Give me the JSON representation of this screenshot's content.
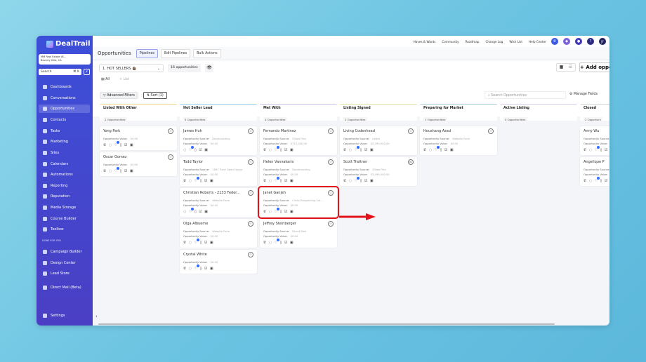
{
  "app": {
    "name": "DealTrail",
    "account": "MM Real Estate (B...",
    "account_location": "Beverly Hills, CA",
    "search_placeholder": "Search",
    "search_shortcut": "⌘ K"
  },
  "sidebar": {
    "items": [
      "Dashboards",
      "Conversations",
      "Opportunities",
      "Contacts",
      "Tasks",
      "Marketing",
      "Sites",
      "Calendars",
      "Automations",
      "Reporting",
      "Reputation",
      "Media Storage",
      "Course Builder",
      "Toolbox"
    ],
    "section": "DONE FOR YOU",
    "extra": [
      "Campaign Builder",
      "Design Center",
      "Lead Store",
      "Direct Mail (Beta)"
    ],
    "settings": "Settings",
    "active": "Opportunities"
  },
  "topbar": {
    "links": [
      "Haves & Wants",
      "Community",
      "Roadmap",
      "Change Log",
      "Wish List",
      "Help Center"
    ],
    "avatar": "JF"
  },
  "header": {
    "title": "Opportunities",
    "tabs": [
      "Pipelines",
      "Edit Pipelines",
      "Bulk Actions"
    ]
  },
  "toolbar": {
    "pipeline": "1. HOT SELLERS 🏚️",
    "count": "16 opportunities",
    "add": "Add opportunity",
    "all": "All",
    "list": "+ List",
    "filters": "Advanced Filters",
    "sort": "Sort (1)",
    "search_placeholder": "Search Opportunities",
    "manage": "Manage Fields"
  },
  "labels": {
    "source": "Opportunity Source:",
    "value": "Opportunity Value:"
  },
  "columns": [
    {
      "name": "Listed With Other",
      "count": "2 Opportunities",
      "color": "#f2d98a",
      "cards": [
        {
          "name": "Yong Park",
          "value": "$0.00",
          "phone": true
        },
        {
          "name": "Oscar Gomez",
          "value": "$0.00",
          "phone": true
        }
      ]
    },
    {
      "name": "Hot Seller Lead",
      "count": "5 Opportunities",
      "color": "#8fd0ea",
      "cards": [
        {
          "name": "James Huh",
          "source": "Doorknocking",
          "value": "$0.00",
          "phone": false
        },
        {
          "name": "Todd Taylor",
          "source": "1587 Turin Open House",
          "value": "$0.00",
          "phone": true
        },
        {
          "name": "Christian Roberts - 2133 Feder...",
          "source": "Website Form",
          "value": "$0.00",
          "phone": false
        },
        {
          "name": "Olga Albueme",
          "source": "Website Form",
          "value": "$0.00",
          "phone": true
        },
        {
          "name": "Crystal White",
          "value": "$0.00",
          "phone": true
        }
      ]
    },
    {
      "name": "Met With",
      "count": "4 Opportunities",
      "color": "#c9c3ea",
      "cards": [
        {
          "name": "Fernando Martinez",
          "source": "Zillow Flex",
          "value": "$710,000.00",
          "phone": true
        },
        {
          "name": "Helen Vanvakaris",
          "source": "Doorknocking",
          "value": "$0.00",
          "phone": true
        },
        {
          "name": "Janet Ganjeh",
          "source": "Circle Prospecting Cal...",
          "value": "$0.00",
          "phone": true,
          "highlight": true
        },
        {
          "name": "Jeffrey Steinberger",
          "source": "Direct Mail",
          "value": "$0.00",
          "phone": true
        }
      ]
    },
    {
      "name": "Listing Signed",
      "count": "2 Opportunities",
      "color": "#dfe39a",
      "cards": [
        {
          "name": "Living Codenhead",
          "source": "Letter",
          "value": "$3,490,000.00",
          "phone": true
        },
        {
          "name": "Scott Trattner",
          "source": "Zillow Flex",
          "value": "$3,499,000.00",
          "phone": true,
          "avatar": "JD"
        }
      ]
    },
    {
      "name": "Preparing for Market",
      "count": "1 Opportunities",
      "color": "#a9cdd6",
      "cards": [
        {
          "name": "Houshang Azad",
          "source": "Website Form",
          "value": "$0.00",
          "phone": true
        }
      ]
    },
    {
      "name": "Active Listing",
      "count": "0 Opportunities",
      "color": "#d9cdee",
      "cards": []
    },
    {
      "name": "Closed",
      "count": "2 Opportuni",
      "color": "#cfd6da",
      "cards": [
        {
          "name": "Anny Wu",
          "source": "",
          "value": "",
          "phone": true
        },
        {
          "name": "Angelique P",
          "source": "",
          "value": "",
          "phone": true
        }
      ]
    }
  ],
  "colors": {
    "accent": "#3c4fd8",
    "highlight": "#e3121b"
  }
}
